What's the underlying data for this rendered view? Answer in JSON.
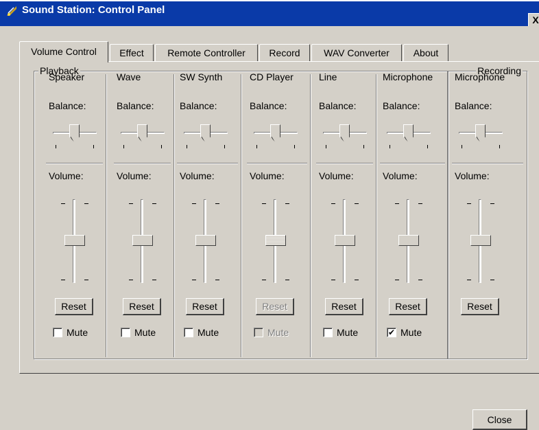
{
  "window": {
    "title": "Sound Station: Control Panel",
    "close_glyph": "X",
    "icon": "sound-station-app-icon",
    "title_bar_color": "#0a3aa8"
  },
  "tabs": [
    {
      "label": "Volume Control",
      "active": true
    },
    {
      "label": "Effect",
      "active": false
    },
    {
      "label": "Remote Controller",
      "active": false
    },
    {
      "label": "Record",
      "active": false
    },
    {
      "label": "WAV Converter",
      "active": false
    },
    {
      "label": "About",
      "active": false
    }
  ],
  "groups": {
    "playback_label": "Playback",
    "recording_label": "Recording"
  },
  "channels": [
    {
      "device": "Speaker",
      "balance_label": "Balance:",
      "volume_label": "Volume:",
      "reset_label": "Reset",
      "mute_label": "Mute",
      "muted": false,
      "enabled": true,
      "balance": 0.5,
      "volume": 0.5
    },
    {
      "device": "Wave",
      "balance_label": "Balance:",
      "volume_label": "Volume:",
      "reset_label": "Reset",
      "mute_label": "Mute",
      "muted": false,
      "enabled": true,
      "balance": 0.5,
      "volume": 0.5
    },
    {
      "device": "SW Synth",
      "balance_label": "Balance:",
      "volume_label": "Volume:",
      "reset_label": "Reset",
      "mute_label": "Mute",
      "muted": false,
      "enabled": true,
      "balance": 0.5,
      "volume": 0.5
    },
    {
      "device": "CD Player",
      "balance_label": "Balance:",
      "volume_label": "Volume:",
      "reset_label": "Reset",
      "mute_label": "Mute",
      "muted": false,
      "enabled": false,
      "balance": 0.5,
      "volume": 0.5
    },
    {
      "device": "Line",
      "balance_label": "Balance:",
      "volume_label": "Volume:",
      "reset_label": "Reset",
      "mute_label": "Mute",
      "muted": false,
      "enabled": true,
      "balance": 0.5,
      "volume": 0.5
    },
    {
      "device": "Microphone",
      "balance_label": "Balance:",
      "volume_label": "Volume:",
      "reset_label": "Reset",
      "mute_label": "Mute",
      "muted": true,
      "enabled": true,
      "balance": 0.5,
      "volume": 0.5
    },
    {
      "device": "Microphone",
      "balance_label": "Balance:",
      "volume_label": "Volume:",
      "reset_label": "Reset",
      "enabled": true,
      "balance": 0.5,
      "volume": 0.5
    }
  ],
  "footer": {
    "close_label": "Close"
  }
}
